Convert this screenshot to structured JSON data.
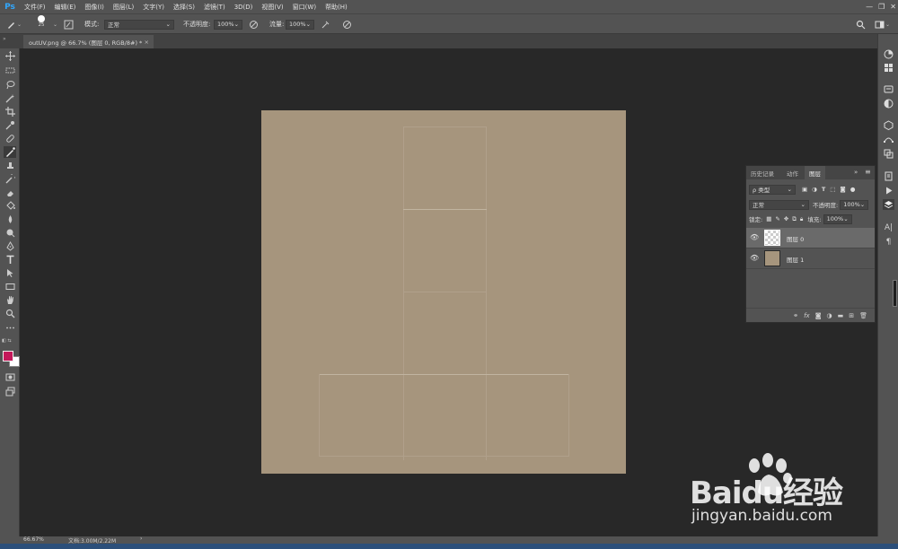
{
  "app": {
    "logo": "Ps",
    "menus": [
      "文件(F)",
      "编辑(E)",
      "图像(I)",
      "图层(L)",
      "文字(Y)",
      "选择(S)",
      "滤镜(T)",
      "3D(D)",
      "视图(V)",
      "窗口(W)",
      "帮助(H)"
    ]
  },
  "window_controls": {
    "minimize": "—",
    "restore": "❐",
    "close": "✕"
  },
  "options_bar": {
    "brush_size": "25",
    "mode_label": "模式:",
    "mode_value": "正常",
    "opacity_label": "不透明度:",
    "opacity_value": "100%",
    "flow_label": "流量:",
    "flow_value": "100%"
  },
  "document_tab": {
    "title": "outUV.png @ 66.7% (图层 0, RGB/8#) *",
    "close": "×"
  },
  "layers_panel": {
    "tabs": [
      "历史记录",
      "动作",
      "图层"
    ],
    "active_tab": "图层",
    "filter_label": "ρ 类型",
    "blend_mode": "正常",
    "opacity_label": "不透明度:",
    "opacity_value": "100%",
    "lock_label": "锁定:",
    "fill_label": "填充:",
    "fill_value": "100%",
    "layers": [
      {
        "name": "图层 0",
        "selected": true
      },
      {
        "name": "图层 1",
        "selected": false
      }
    ],
    "footer_icons": [
      "link-icon",
      "fx-icon",
      "mask-icon",
      "adjustment-icon",
      "folder-icon",
      "new-layer-icon",
      "trash-icon"
    ]
  },
  "status_bar": {
    "zoom": "66.67%",
    "doc_info": "文档:3.00M/2.22M",
    "arrow": "›"
  },
  "watermark": {
    "brand": "Baidu经验",
    "url": "jingyan.baidu.com"
  },
  "colors": {
    "canvas": "#a6957d",
    "foreground": "#c4185a",
    "background": "#ffffff",
    "ui_panel": "#535353",
    "workspace": "#282828"
  }
}
